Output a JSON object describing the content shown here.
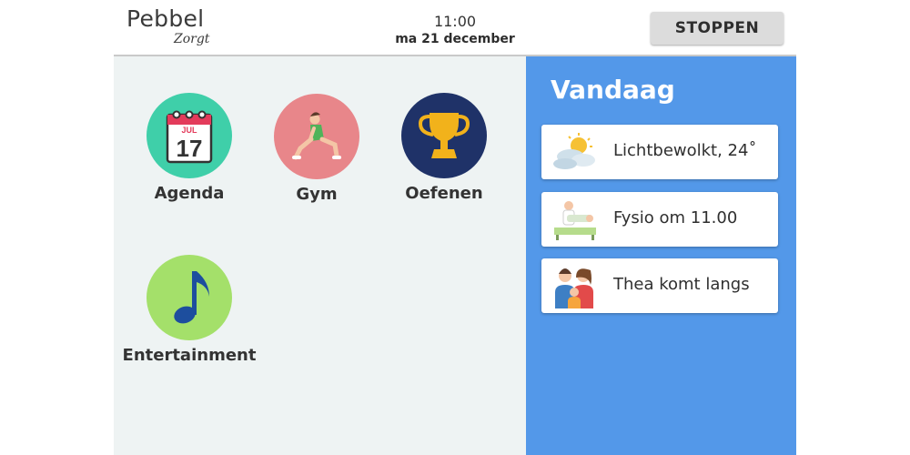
{
  "header": {
    "brand_name": "Pebbel",
    "brand_sub": "Zorgt",
    "time": "11:00",
    "date": "ma 21 december",
    "stop_label": "STOPPEN"
  },
  "apps": [
    {
      "label": "Agenda",
      "icon": "calendar-icon",
      "color": "#3fcfa9",
      "calendar_month": "JUL",
      "calendar_day": "17"
    },
    {
      "label": "Gym",
      "icon": "exercise-icon",
      "color": "#e8868a"
    },
    {
      "label": "Oefenen",
      "icon": "trophy-icon",
      "color": "#1f3268"
    },
    {
      "label": "Entertainment",
      "icon": "music-note-icon",
      "color": "#a4e06a"
    }
  ],
  "today": {
    "title": "Vandaag",
    "items": [
      {
        "text": "Lichtbewolkt, 24˚",
        "icon": "weather-partly-cloudy-icon"
      },
      {
        "text": "Fysio om 11.00",
        "icon": "physiotherapy-icon"
      },
      {
        "text": "Thea komt langs",
        "icon": "family-visit-icon"
      }
    ]
  },
  "colors": {
    "panel_left": "#eef3f3",
    "panel_right": "#5398e9",
    "stop_button": "#dcdcdc"
  }
}
